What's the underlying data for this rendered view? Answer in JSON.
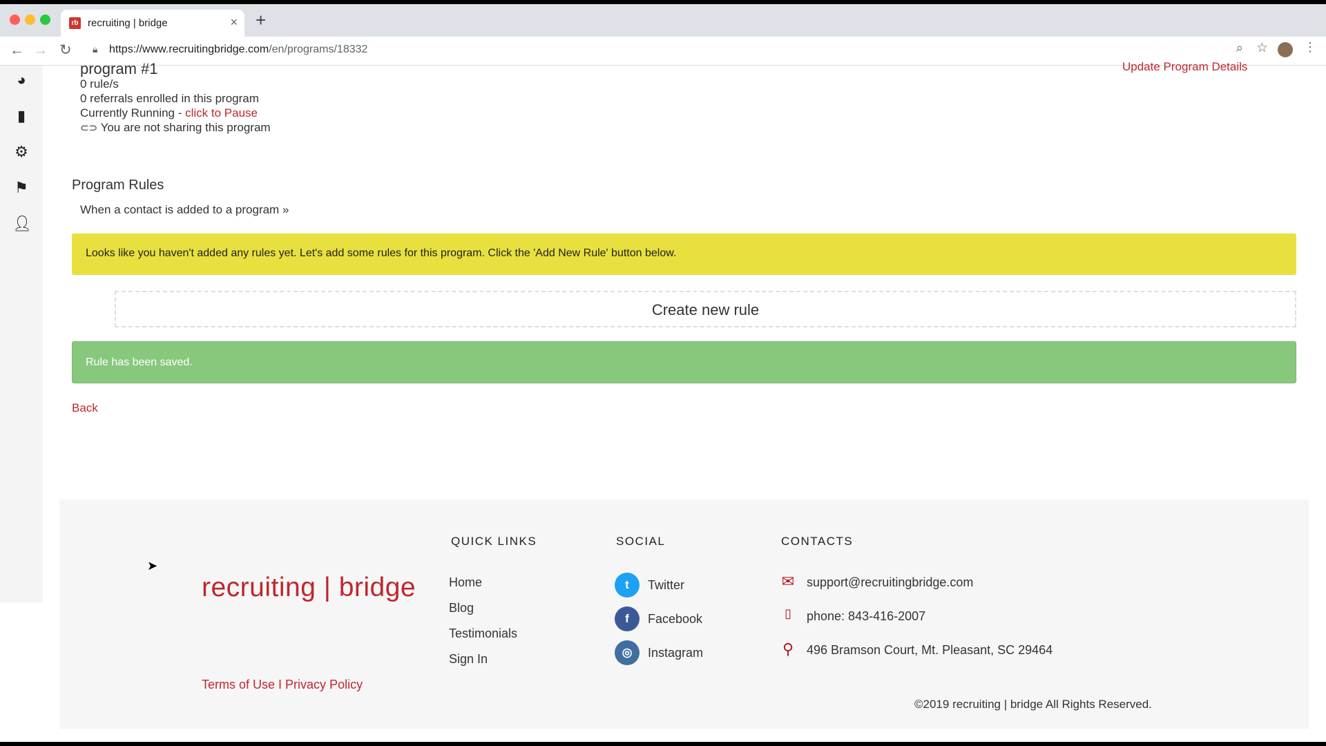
{
  "browser": {
    "tab_title": "recruiting | bridge",
    "favicon_text": "rb",
    "url_host": "https://www.recruitingbridge.com",
    "url_path": "/en/programs/18332"
  },
  "program": {
    "title": "program #1",
    "rules_count": "0 rule/s",
    "referrals": "0 referrals enrolled in this program",
    "status_prefix": "Currently Running - ",
    "pause_link": "click to Pause",
    "sharing": "You are not sharing this program",
    "update_link": "Update Program Details"
  },
  "rules": {
    "heading": "Program Rules",
    "trigger": "When a contact is added to a program »",
    "empty_notice": "Looks like you haven't added any rules yet. Let's add some rules for this program. Click the 'Add New Rule' button below.",
    "create_label": "Create new rule",
    "saved_notice": "Rule has been saved.",
    "back_label": "Back"
  },
  "footer": {
    "brand": "recruiting | bridge",
    "terms": "Terms of Use",
    "separator": " I ",
    "privacy": "Privacy Policy",
    "quick_links_heading": "QUICK LINKS",
    "quick_links": [
      "Home",
      "Blog",
      "Testimonials",
      "Sign In"
    ],
    "social_heading": "SOCIAL",
    "social": [
      {
        "label": "Twitter",
        "icon": "twitter-icon",
        "color": "#1da1f2"
      },
      {
        "label": "Facebook",
        "icon": "facebook-icon",
        "color": "#3b5998"
      },
      {
        "label": "Instagram",
        "icon": "instagram-icon",
        "color": "#3f6fa0"
      }
    ],
    "contacts_heading": "CONTACTS",
    "email": "support@recruitingbridge.com",
    "phone": "phone: 843-416-2007",
    "address": "496 Bramson Court, Mt. Pleasant, SC 29464",
    "copyright": "©2019 recruiting | bridge All Rights Reserved."
  },
  "colors": {
    "accent": "#c0262d",
    "warning": "#e8e03e",
    "success": "#87c87d"
  }
}
